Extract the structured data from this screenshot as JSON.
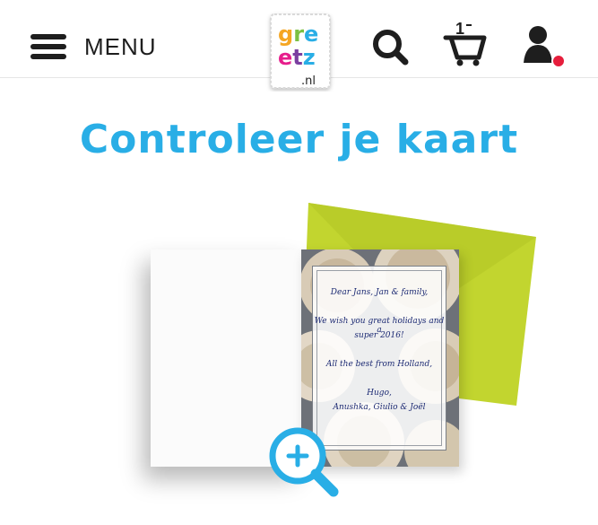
{
  "header": {
    "menu_label": "MENU",
    "logo": {
      "line1": "gre",
      "line2": "etz",
      "suffix": ".nl"
    },
    "cart_count": "1",
    "icons": {
      "menu": "hamburger-icon",
      "search": "search-icon",
      "cart": "cart-icon",
      "account": "user-icon",
      "notification": "notification-dot"
    },
    "colors": {
      "notification": "#e61e3c"
    }
  },
  "page": {
    "title": "Controleer je kaart"
  },
  "card": {
    "message": [
      "Dear Jans, Jan & family,",
      "We wish you great holidays and a",
      "super 2016!",
      "All the best from Holland,",
      "Hugo,",
      "Anushka, Giulio & Joël"
    ],
    "envelope_color": "#c2d52f",
    "zoom_icon": "zoom-in-icon"
  },
  "colors": {
    "accent": "#29aee6",
    "text": "#1e1e1e"
  }
}
